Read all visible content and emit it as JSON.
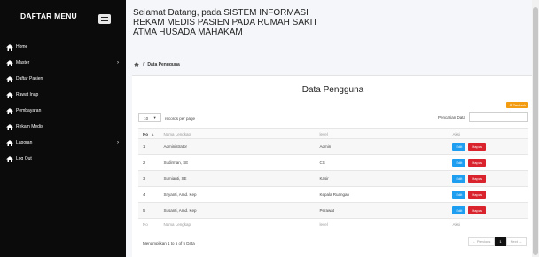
{
  "sidebar": {
    "title": "DAFTAR MENU",
    "items": [
      {
        "label": "Home",
        "chevron": ""
      },
      {
        "label": "Master",
        "chevron": "›"
      },
      {
        "label": "Daftar Pasien",
        "chevron": ""
      },
      {
        "label": "Rawat Inap",
        "chevron": ""
      },
      {
        "label": "Pembayaran",
        "chevron": ""
      },
      {
        "label": "Rekam Medis",
        "chevron": ""
      },
      {
        "label": "Laporan",
        "chevron": "›"
      },
      {
        "label": "Log Out",
        "chevron": ""
      }
    ]
  },
  "header": {
    "line1": "Selamat Datang, pada SISTEM INFORMASI",
    "line2": "REKAM MEDIS PASIEN PADA RUMAH SAKIT",
    "line3": "ATMA HUSADA MAHAKAM"
  },
  "breadcrumb": {
    "sep": "/",
    "current": "Data Pengguna"
  },
  "card": {
    "title": "Data Pengguna",
    "add_button": "⊕ Tambah",
    "length_value": "10",
    "length_caret": "▾",
    "length_label": "records per page",
    "search_label": "Pencarian Data",
    "search_value": "",
    "columns": {
      "no": "No",
      "sort": "▲",
      "nama": "Nama Lengkap",
      "level": "level",
      "aksi": "Aksi"
    },
    "rows": [
      {
        "no": "1",
        "nama": "Administrator",
        "level": "Admin"
      },
      {
        "no": "2",
        "nama": "Sudirman, SE",
        "level": "CS"
      },
      {
        "no": "3",
        "nama": "Sumianti, SE",
        "level": "Kasir"
      },
      {
        "no": "4",
        "nama": "Sriyanti, Amd. Kep",
        "level": "Kepala Ruangan"
      },
      {
        "no": "5",
        "nama": "Susanti, Amd. Kep",
        "level": "Perawat"
      }
    ],
    "edit_label": "Edit",
    "delete_label": "Hapus",
    "info": "Menampilkan 1 to 5 of 5 Data",
    "pager": {
      "prev": "← Previous",
      "page": "1",
      "next": "Next →"
    }
  },
  "colors": {
    "sidebar_bg": "#0b0b0b",
    "edit": "#1e9ef0",
    "delete": "#d9232d",
    "add": "#f39c12"
  },
  "icons": [
    "menu-icon",
    "home-icon",
    "chevron-right-icon",
    "sort-up-icon"
  ]
}
